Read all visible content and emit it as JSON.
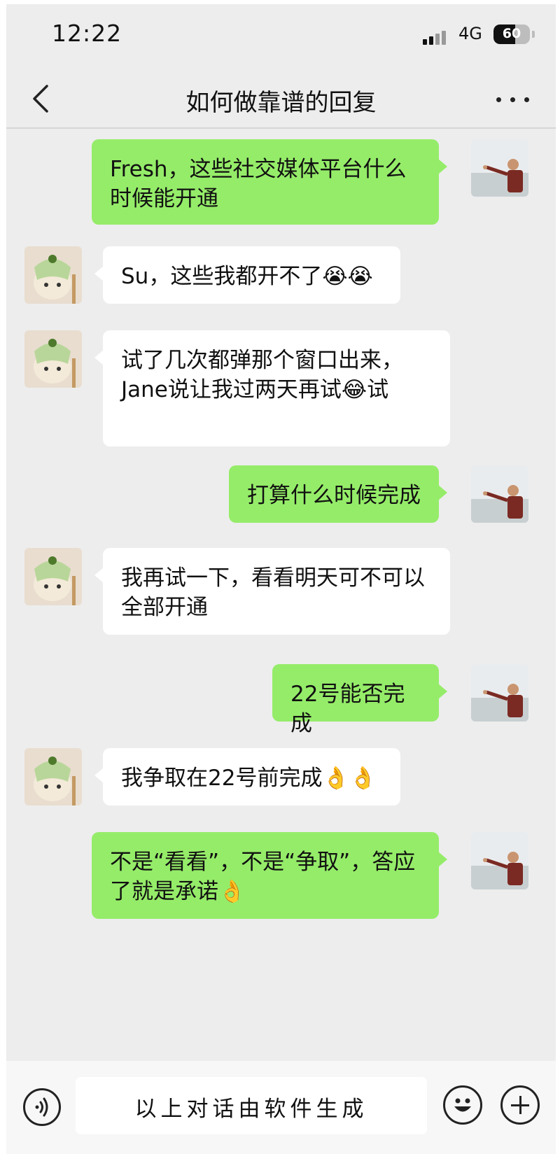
{
  "status_bar": {
    "time": "12:22",
    "network": "4G",
    "battery": "60",
    "battery_level": 0.6
  },
  "nav": {
    "title": "如何做靠谱的回复",
    "back_icon": "chevron-left-icon",
    "more_icon": "more-dots-icon"
  },
  "messages": [
    {
      "sender": "self",
      "text": "Fresh，这些社交媒体平台什么时候能开通"
    },
    {
      "sender": "other",
      "text": "Su，这些我都开不了😭😭"
    },
    {
      "sender": "other",
      "text": "试了几次都弹那个窗口出来，Jane说让我过两天再试😂试"
    },
    {
      "sender": "self",
      "text": "打算什么时候完成"
    },
    {
      "sender": "other",
      "text": "我再试一下，看看明天可不可以全部开通"
    },
    {
      "sender": "self",
      "text": "22号能否完成"
    },
    {
      "sender": "other",
      "text": "我争取在22号前完成👌👌"
    },
    {
      "sender": "self",
      "text": "不是“看看”，不是“争取”，答应了就是承诺👌"
    }
  ],
  "input": {
    "value": "以上对话由软件生成",
    "voice_icon": "voice-icon",
    "emoji_icon": "emoji-smile-icon",
    "plus_icon": "plus-circle-icon"
  },
  "colors": {
    "chat_bg": "#ededed",
    "self_bubble": "#95ec69",
    "other_bubble": "#ffffff"
  }
}
